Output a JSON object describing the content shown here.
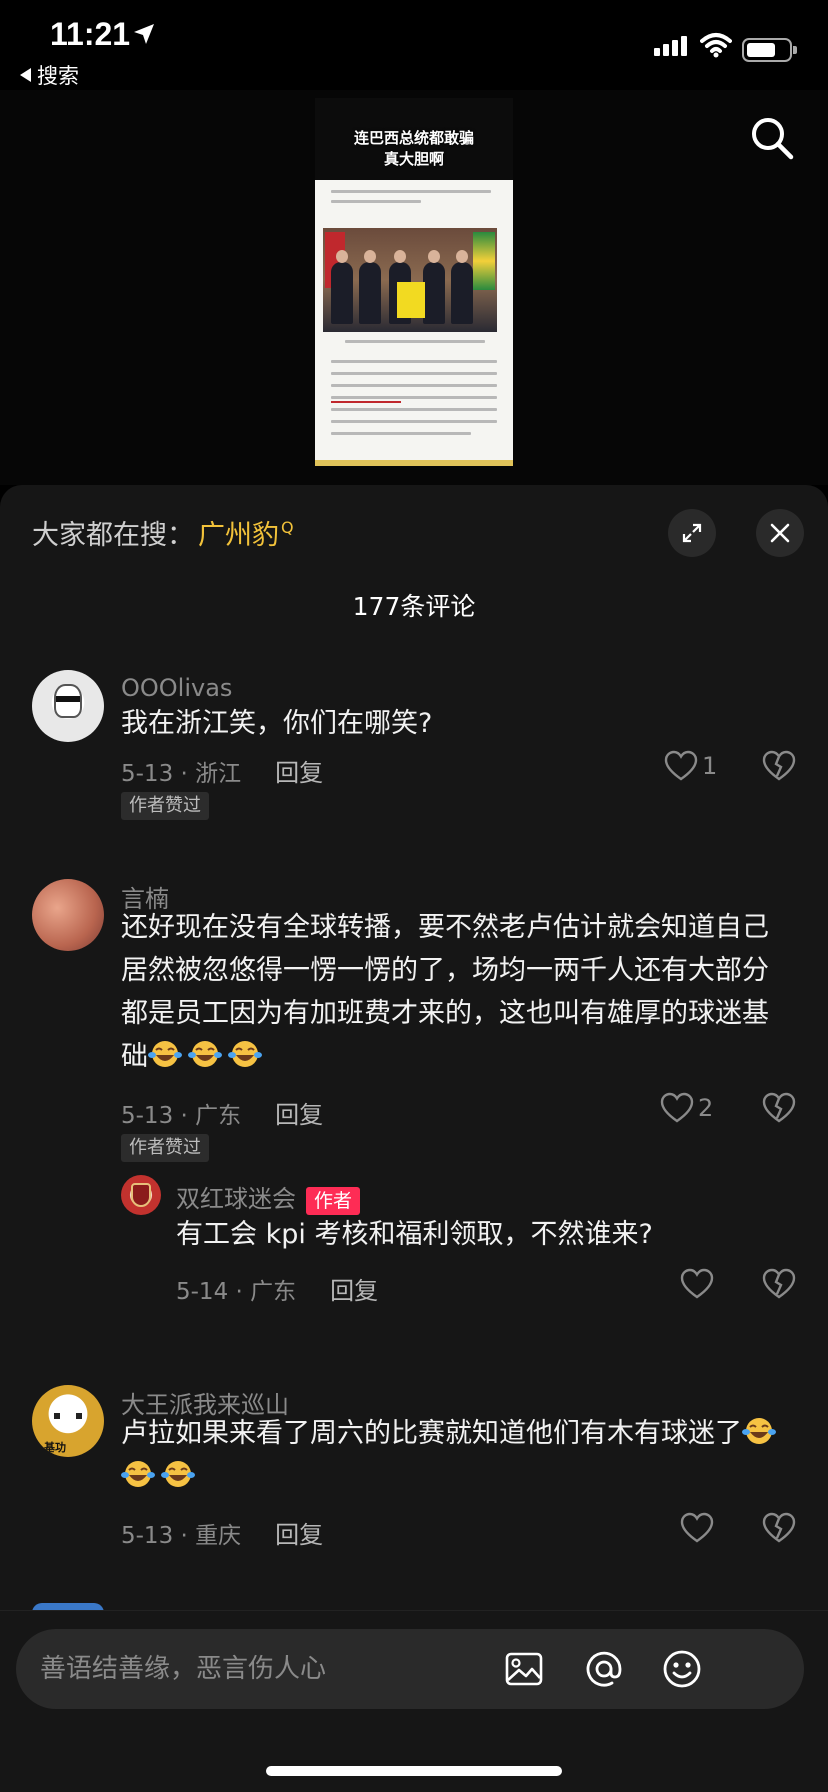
{
  "status_bar": {
    "time": "11:21",
    "back_label": "搜索"
  },
  "video": {
    "thumbnail_title_line1": "连巴西总统都敢骗",
    "thumbnail_title_line2": "真大胆啊"
  },
  "sheet": {
    "hot_search_label": "大家都在搜：",
    "hot_search_term": "广州豹",
    "comment_count_label": "177条评论"
  },
  "comments": [
    {
      "username": "OOOlivas",
      "text": "我在浙江笑，你们在哪笑?",
      "date_location": "5-13 · 浙江",
      "reply_label": "回复",
      "likes": "1",
      "badge": "作者赞过"
    },
    {
      "username": "言楠",
      "text": "还好现在没有全球转播，要不然老卢估计就会知道自己居然被忽悠得一愣一愣的了，场均一两千人还有大部分都是员工因为有加班费才来的，这也叫有雄厚的球迷基础",
      "date_location": "5-13 · 广东",
      "reply_label": "回复",
      "likes": "2",
      "badge": "作者赞过",
      "reply": {
        "username": "双红球迷会",
        "author_tag": "作者",
        "text": "有工会 kpi 考核和福利领取，不然谁来?",
        "date_location": "5-14 · 广东",
        "reply_label": "回复"
      }
    },
    {
      "username": "大王派我来巡山",
      "text": "卢拉如果来看了周六的比赛就知道他们有木有球迷了",
      "date_location": "5-13 · 重庆",
      "reply_label": "回复",
      "avatar_text": "基功"
    }
  ],
  "input": {
    "placeholder": "善语结善缘，恶言伤人心"
  },
  "icons": [
    "location-arrow-icon",
    "back-triangle-icon",
    "signal-icon",
    "wifi-icon",
    "battery-icon",
    "search-icon",
    "expand-icon",
    "close-icon",
    "heart-icon",
    "dislike-heart-icon",
    "laugh-cry-emoji",
    "image-icon",
    "at-icon",
    "emoji-icon"
  ],
  "colors": {
    "accent_yellow": "#f2c23a",
    "author_red": "#fe2c55",
    "sheet_bg": "#161616"
  }
}
